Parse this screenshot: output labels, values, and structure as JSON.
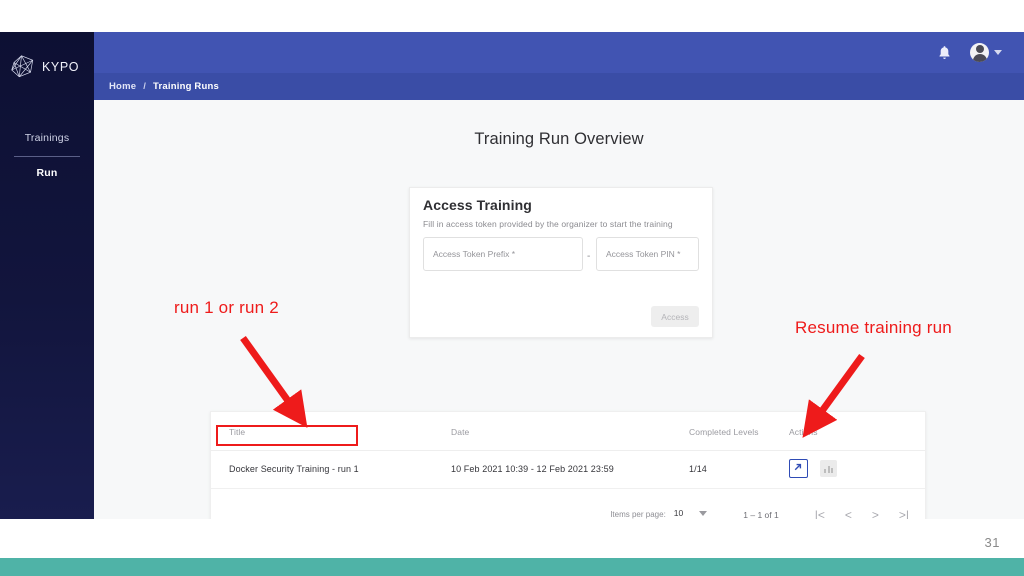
{
  "slide": {
    "page_number": "31",
    "accent_bar_color": "#4fb3a7"
  },
  "app": {
    "sidebar": {
      "brand": "KYPO",
      "logo_icon": "kypo-polyhedron-logo-icon",
      "section_title": "Trainings",
      "items": [
        {
          "label": "Run",
          "active": true
        }
      ]
    },
    "topbar": {
      "background": "#4154b2",
      "notifications_icon": "bell-icon",
      "account_icon": "user-avatar-icon",
      "account_caret_icon": "chevron-down-icon"
    },
    "breadcrumb": {
      "items": [
        "Home",
        "Training Runs"
      ],
      "separator": "/"
    },
    "page_title": "Training Run Overview",
    "access_card": {
      "title": "Access Training",
      "subtitle": "Fill in access token provided by the organizer to start the training",
      "token_prefix_placeholder": "Access Token Prefix *",
      "token_pin_placeholder": "Access Token PIN *",
      "separator": "-",
      "submit_label": "Access"
    },
    "table": {
      "columns": [
        "Title",
        "Date",
        "Completed Levels",
        "Actions"
      ],
      "rows": [
        {
          "title": "Docker Security Training - run 1",
          "date": "10 Feb 2021 10:39 - 12 Feb 2021 23:59",
          "completed_levels": "1/14",
          "actions": [
            "open-in-new-icon",
            "bar-chart-icon"
          ]
        }
      ],
      "paginator": {
        "items_per_page_label": "Items per page:",
        "items_per_page_value": "10",
        "range_label": "1 – 1 of 1",
        "first_page_icon": "|<",
        "prev_page_icon": "<",
        "next_page_icon": ">",
        "last_page_icon": ">|"
      }
    }
  },
  "annotations": {
    "color": "#ee1b1b",
    "left_label": "run 1 or run 2",
    "right_label": "Resume training run"
  }
}
